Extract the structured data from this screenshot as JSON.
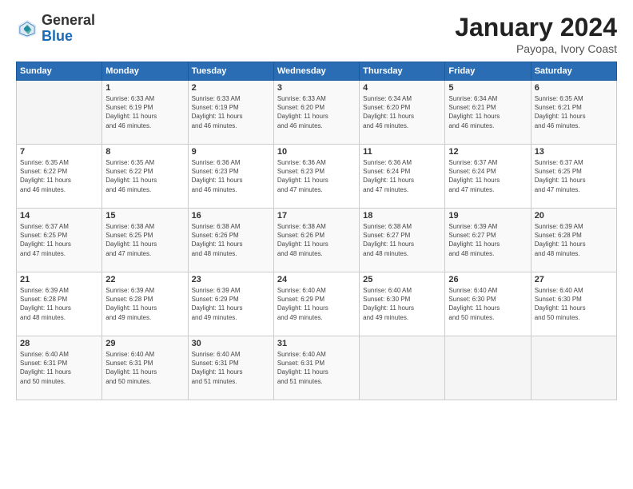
{
  "logo": {
    "general": "General",
    "blue": "Blue"
  },
  "header": {
    "month": "January 2024",
    "location": "Payopa, Ivory Coast"
  },
  "days_of_week": [
    "Sunday",
    "Monday",
    "Tuesday",
    "Wednesday",
    "Thursday",
    "Friday",
    "Saturday"
  ],
  "weeks": [
    [
      {
        "day": "",
        "info": ""
      },
      {
        "day": "1",
        "info": "Sunrise: 6:33 AM\nSunset: 6:19 PM\nDaylight: 11 hours\nand 46 minutes."
      },
      {
        "day": "2",
        "info": "Sunrise: 6:33 AM\nSunset: 6:19 PM\nDaylight: 11 hours\nand 46 minutes."
      },
      {
        "day": "3",
        "info": "Sunrise: 6:33 AM\nSunset: 6:20 PM\nDaylight: 11 hours\nand 46 minutes."
      },
      {
        "day": "4",
        "info": "Sunrise: 6:34 AM\nSunset: 6:20 PM\nDaylight: 11 hours\nand 46 minutes."
      },
      {
        "day": "5",
        "info": "Sunrise: 6:34 AM\nSunset: 6:21 PM\nDaylight: 11 hours\nand 46 minutes."
      },
      {
        "day": "6",
        "info": "Sunrise: 6:35 AM\nSunset: 6:21 PM\nDaylight: 11 hours\nand 46 minutes."
      }
    ],
    [
      {
        "day": "7",
        "info": "Sunrise: 6:35 AM\nSunset: 6:22 PM\nDaylight: 11 hours\nand 46 minutes."
      },
      {
        "day": "8",
        "info": "Sunrise: 6:35 AM\nSunset: 6:22 PM\nDaylight: 11 hours\nand 46 minutes."
      },
      {
        "day": "9",
        "info": "Sunrise: 6:36 AM\nSunset: 6:23 PM\nDaylight: 11 hours\nand 46 minutes."
      },
      {
        "day": "10",
        "info": "Sunrise: 6:36 AM\nSunset: 6:23 PM\nDaylight: 11 hours\nand 47 minutes."
      },
      {
        "day": "11",
        "info": "Sunrise: 6:36 AM\nSunset: 6:24 PM\nDaylight: 11 hours\nand 47 minutes."
      },
      {
        "day": "12",
        "info": "Sunrise: 6:37 AM\nSunset: 6:24 PM\nDaylight: 11 hours\nand 47 minutes."
      },
      {
        "day": "13",
        "info": "Sunrise: 6:37 AM\nSunset: 6:25 PM\nDaylight: 11 hours\nand 47 minutes."
      }
    ],
    [
      {
        "day": "14",
        "info": "Sunrise: 6:37 AM\nSunset: 6:25 PM\nDaylight: 11 hours\nand 47 minutes."
      },
      {
        "day": "15",
        "info": "Sunrise: 6:38 AM\nSunset: 6:25 PM\nDaylight: 11 hours\nand 47 minutes."
      },
      {
        "day": "16",
        "info": "Sunrise: 6:38 AM\nSunset: 6:26 PM\nDaylight: 11 hours\nand 48 minutes."
      },
      {
        "day": "17",
        "info": "Sunrise: 6:38 AM\nSunset: 6:26 PM\nDaylight: 11 hours\nand 48 minutes."
      },
      {
        "day": "18",
        "info": "Sunrise: 6:38 AM\nSunset: 6:27 PM\nDaylight: 11 hours\nand 48 minutes."
      },
      {
        "day": "19",
        "info": "Sunrise: 6:39 AM\nSunset: 6:27 PM\nDaylight: 11 hours\nand 48 minutes."
      },
      {
        "day": "20",
        "info": "Sunrise: 6:39 AM\nSunset: 6:28 PM\nDaylight: 11 hours\nand 48 minutes."
      }
    ],
    [
      {
        "day": "21",
        "info": "Sunrise: 6:39 AM\nSunset: 6:28 PM\nDaylight: 11 hours\nand 48 minutes."
      },
      {
        "day": "22",
        "info": "Sunrise: 6:39 AM\nSunset: 6:28 PM\nDaylight: 11 hours\nand 49 minutes."
      },
      {
        "day": "23",
        "info": "Sunrise: 6:39 AM\nSunset: 6:29 PM\nDaylight: 11 hours\nand 49 minutes."
      },
      {
        "day": "24",
        "info": "Sunrise: 6:40 AM\nSunset: 6:29 PM\nDaylight: 11 hours\nand 49 minutes."
      },
      {
        "day": "25",
        "info": "Sunrise: 6:40 AM\nSunset: 6:30 PM\nDaylight: 11 hours\nand 49 minutes."
      },
      {
        "day": "26",
        "info": "Sunrise: 6:40 AM\nSunset: 6:30 PM\nDaylight: 11 hours\nand 50 minutes."
      },
      {
        "day": "27",
        "info": "Sunrise: 6:40 AM\nSunset: 6:30 PM\nDaylight: 11 hours\nand 50 minutes."
      }
    ],
    [
      {
        "day": "28",
        "info": "Sunrise: 6:40 AM\nSunset: 6:31 PM\nDaylight: 11 hours\nand 50 minutes."
      },
      {
        "day": "29",
        "info": "Sunrise: 6:40 AM\nSunset: 6:31 PM\nDaylight: 11 hours\nand 50 minutes."
      },
      {
        "day": "30",
        "info": "Sunrise: 6:40 AM\nSunset: 6:31 PM\nDaylight: 11 hours\nand 51 minutes."
      },
      {
        "day": "31",
        "info": "Sunrise: 6:40 AM\nSunset: 6:31 PM\nDaylight: 11 hours\nand 51 minutes."
      },
      {
        "day": "",
        "info": ""
      },
      {
        "day": "",
        "info": ""
      },
      {
        "day": "",
        "info": ""
      }
    ]
  ]
}
